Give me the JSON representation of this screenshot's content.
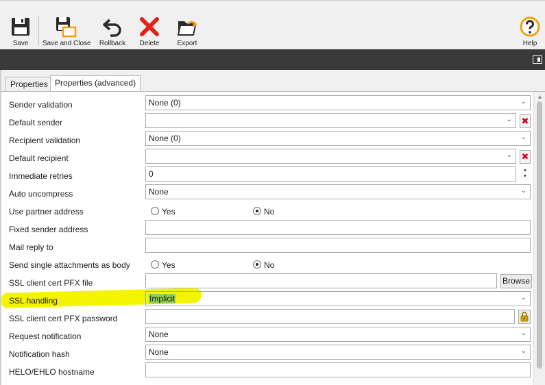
{
  "toolbar": {
    "buttons": [
      {
        "label": "Save",
        "icon": "floppy-disk-icon"
      },
      {
        "label": "Save and Close",
        "icon": "save-close-icon"
      },
      {
        "label": "Rollback",
        "icon": "undo-arrow-icon"
      },
      {
        "label": "Delete",
        "icon": "red-x-icon"
      },
      {
        "label": "Export",
        "icon": "folder-export-icon"
      },
      {
        "label": "Help",
        "icon": "help-circle-icon"
      }
    ]
  },
  "tabs": [
    {
      "label": "Properties"
    },
    {
      "label": "Properties (advanced)",
      "active": true
    }
  ],
  "form": {
    "rows": [
      {
        "label": "Sender validation",
        "value": "None (0)"
      },
      {
        "label": "Default sender",
        "value": ""
      },
      {
        "label": "Recipient validation",
        "value": "None (0)"
      },
      {
        "label": "Default recipient",
        "value": ""
      },
      {
        "label": "Immediate retries",
        "value": "0"
      },
      {
        "label": "Auto uncompress",
        "value": "None"
      },
      {
        "label": "Use partner address",
        "yes": "Yes",
        "no": "No",
        "selected": "no"
      },
      {
        "label": "Fixed sender address",
        "value": ""
      },
      {
        "label": "Mail reply to",
        "value": ""
      },
      {
        "label": "Send single attachments as body",
        "yes": "Yes",
        "no": "No",
        "selected": "no"
      },
      {
        "label": "SSL client cert PFX file",
        "value": "",
        "button": "Browse"
      },
      {
        "label": "SSL handling",
        "value": "Implicit"
      },
      {
        "label": "SSL client cert PFX password",
        "value": ""
      },
      {
        "label": "Request notification",
        "value": "None"
      },
      {
        "label": "Notification hash",
        "value": "None"
      },
      {
        "label": "HELO/EHLO hostname",
        "value": ""
      }
    ]
  },
  "colors": {
    "highlight_yellow": "#f4f300",
    "highlight_green": "#8fd14f",
    "dark_bar": "#3a3a3a",
    "delete_red": "#e0231b",
    "save_orange": "#f39c12",
    "help_orange": "#f0a30a"
  }
}
